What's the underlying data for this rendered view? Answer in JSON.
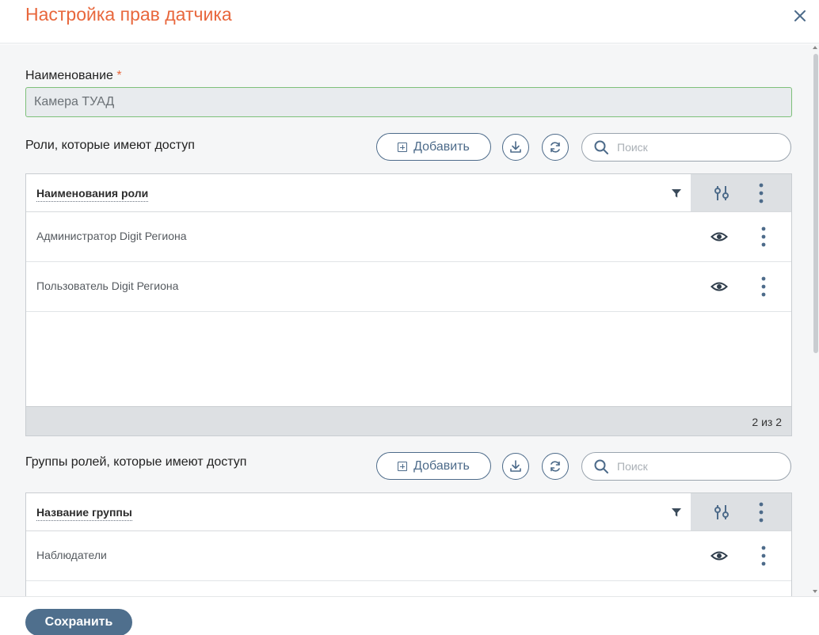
{
  "dialog": {
    "title": "Настройка прав датчика"
  },
  "form": {
    "name_label": "Наименование",
    "required_mark": "*",
    "name_value": "Камера ТУАД"
  },
  "roles": {
    "section_title": "Роли, которые имеют доступ",
    "add_label": "Добавить",
    "search_placeholder": "Поиск",
    "column_header": "Наименования роли",
    "rows": [
      "Администратор Digit Региона",
      "Пользователь Digit Региона"
    ],
    "footer_count": "2 из 2"
  },
  "groups": {
    "section_title": "Группы ролей, которые имеют доступ",
    "add_label": "Добавить",
    "search_placeholder": "Поиск",
    "column_header": "Название группы",
    "rows": [
      "Наблюдатели"
    ]
  },
  "footer": {
    "save_label": "Сохранить"
  },
  "colors": {
    "title": "#e8673c",
    "accent": "#4d6b8a",
    "save_button": "#4f6f8d",
    "input_border": "#7ec07a"
  },
  "icons": [
    "close-icon",
    "add-icon",
    "download-icon",
    "refresh-icon",
    "search-icon",
    "filter-icon",
    "column-settings-icon",
    "kebab-icon",
    "eye-icon"
  ]
}
